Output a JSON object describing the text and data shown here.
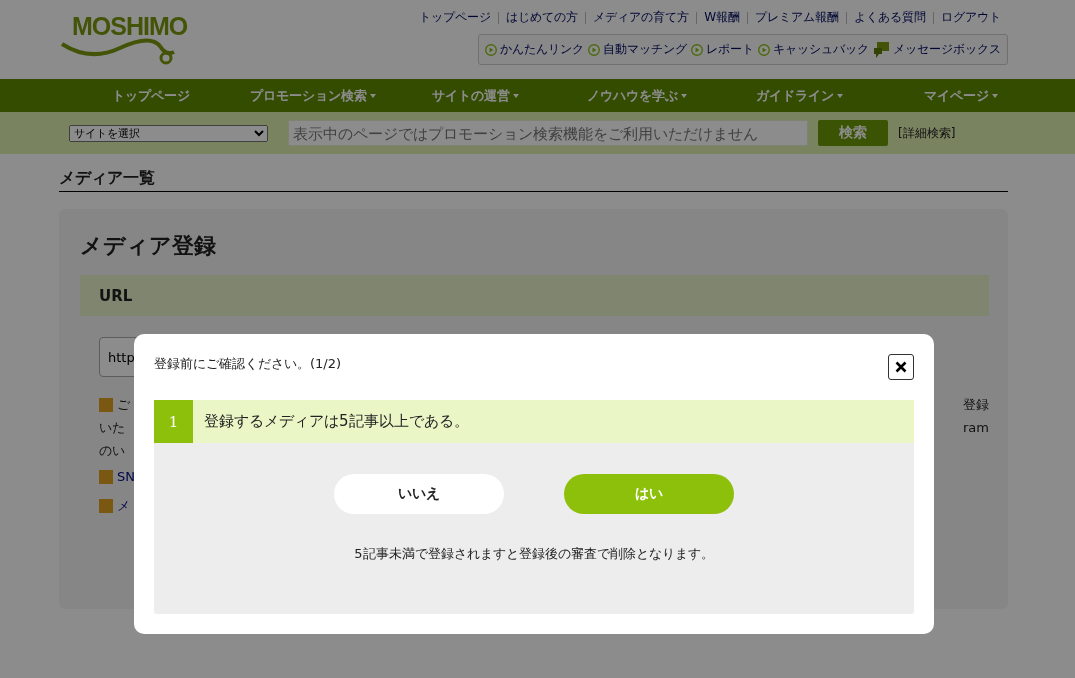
{
  "header": {
    "logo": "MOSHIMO",
    "top_links": [
      "トップページ",
      "はじめての方",
      "メディアの育て方",
      "W報酬",
      "プレミアム報酬",
      "よくある質問",
      "ログアウト"
    ],
    "quick_links": [
      {
        "label": "かんたんリンク",
        "kind": "play"
      },
      {
        "label": "自動マッチング",
        "kind": "play"
      },
      {
        "label": "レポート",
        "kind": "play"
      },
      {
        "label": "キャッシュバック",
        "kind": "play"
      },
      {
        "label": "メッセージボックス",
        "kind": "message"
      }
    ]
  },
  "nav": [
    {
      "label": "トップページ",
      "dropdown": false
    },
    {
      "label": "プロモーション検索",
      "dropdown": true
    },
    {
      "label": "サイトの運営",
      "dropdown": true
    },
    {
      "label": "ノウハウを学ぶ",
      "dropdown": true
    },
    {
      "label": "ガイドライン",
      "dropdown": true
    },
    {
      "label": "マイページ",
      "dropdown": true
    }
  ],
  "search_bar": {
    "site_select": "サイトを選択",
    "placeholder": "表示中のページではプロモーション検索機能をご利用いただけません",
    "search_button": "検索",
    "advanced_link": "[詳細検索]"
  },
  "page_title": "メディア一覧",
  "card": {
    "title": "メディア登録",
    "section": "URL",
    "input_value": "http",
    "notes_left": [
      "ご",
      "いた",
      "のい"
    ],
    "notes_right": [
      "登録",
      "ram"
    ],
    "links": [
      "SN",
      "メ"
    ]
  },
  "modal": {
    "title": "登録前にご確認ください。(1/2)",
    "question": {
      "number": "1",
      "text": "登録するメディアは5記事以上である。"
    },
    "buttons": [
      {
        "label": "いいえ",
        "kind": "secondary"
      },
      {
        "label": "はい",
        "kind": "primary"
      }
    ],
    "note": "5記事未満で登録されますと登録後の審査で削除となります。"
  }
}
